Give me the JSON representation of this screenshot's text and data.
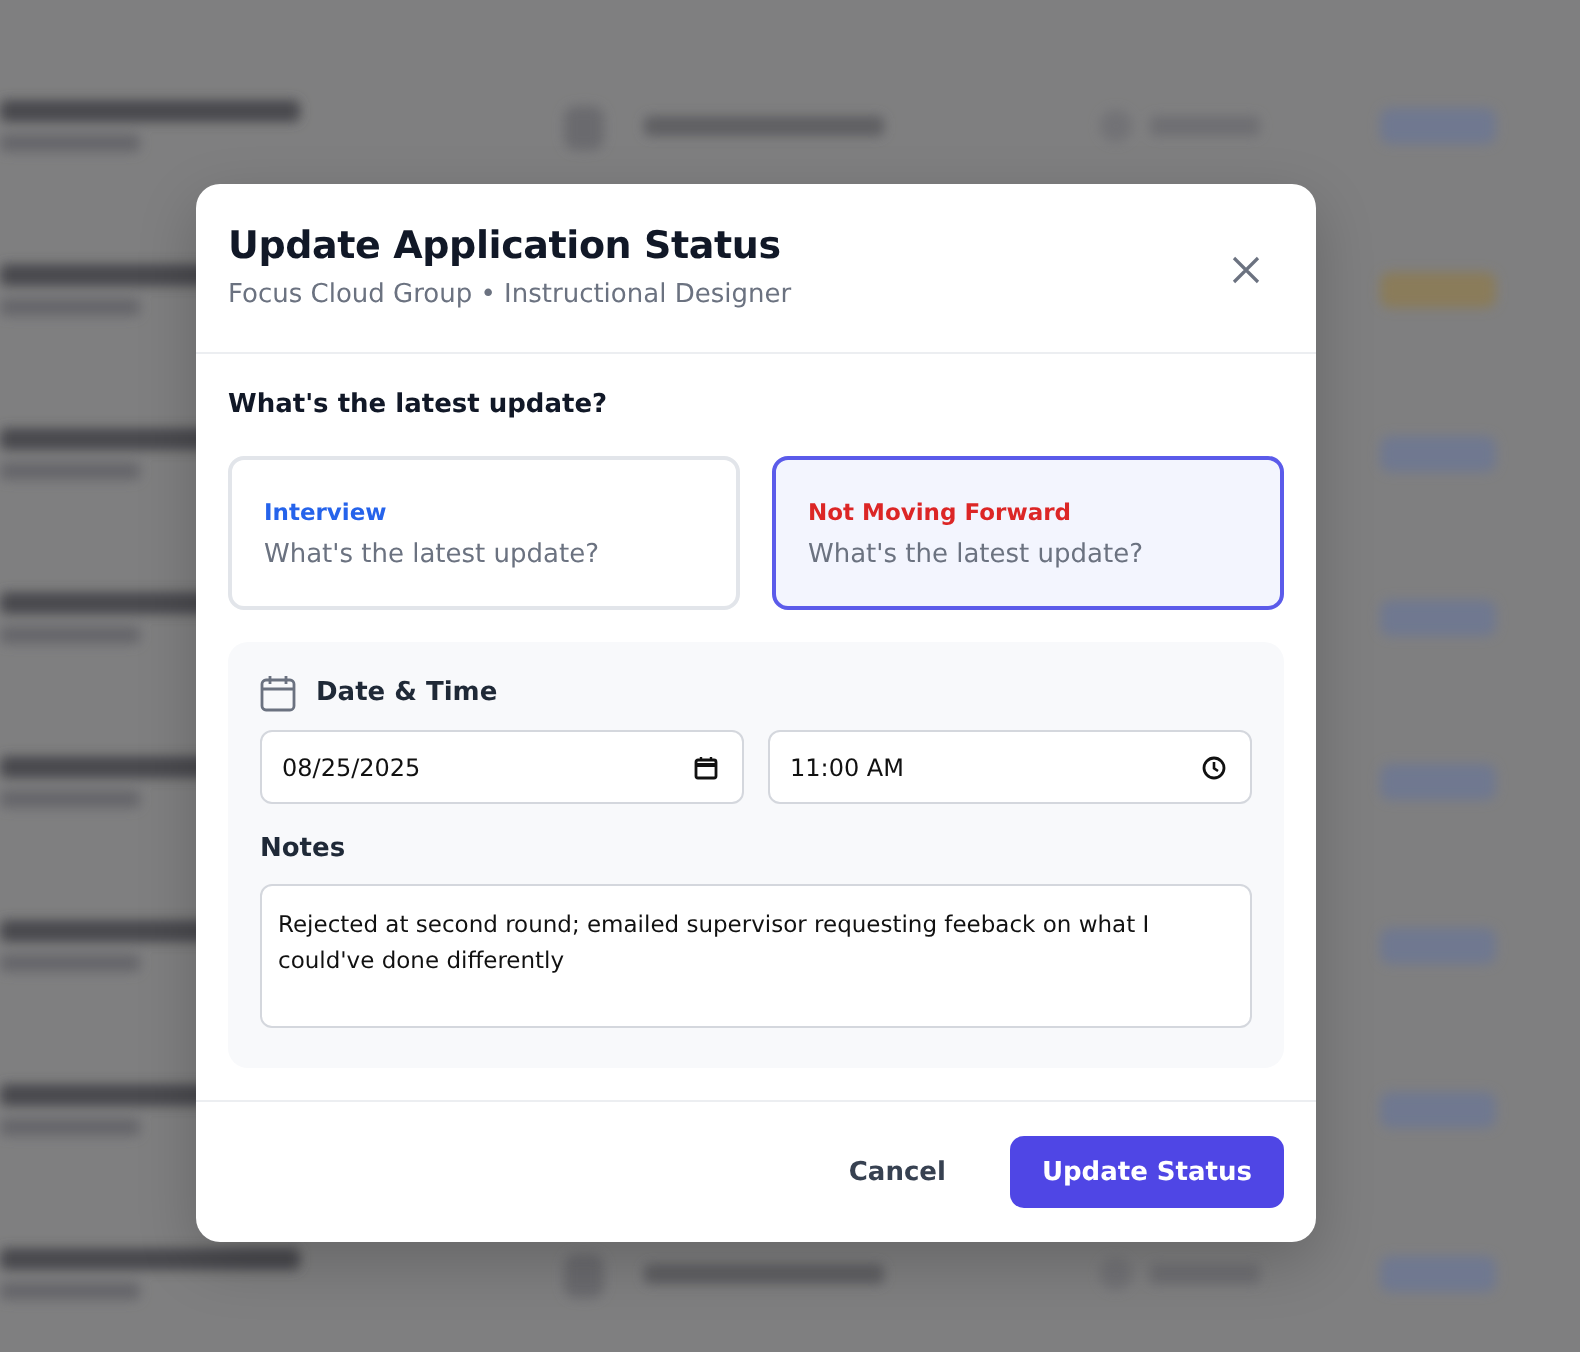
{
  "dialog": {
    "title": "Update Application Status",
    "subtitle": "Focus Cloud Group • Instructional Designer",
    "question": "What's the latest update?",
    "status_options": [
      {
        "label": "Interview",
        "placeholder": "What's the latest update?",
        "color": "#2563eb",
        "selected": false
      },
      {
        "label": "Not Moving Forward",
        "placeholder": "What's the latest update?",
        "color": "#dc2626",
        "selected": true
      }
    ],
    "date_time": {
      "heading": "Date & Time",
      "date": "08/25/2025",
      "time": "11:00 AM"
    },
    "notes": {
      "label": "Notes",
      "value": "Rejected at second round; emailed supervisor requesting feeback on what I could've done differently"
    },
    "buttons": [
      {
        "kind": "secondary",
        "label": "Cancel"
      },
      {
        "kind": "primary",
        "label": "Update Status"
      }
    ]
  }
}
